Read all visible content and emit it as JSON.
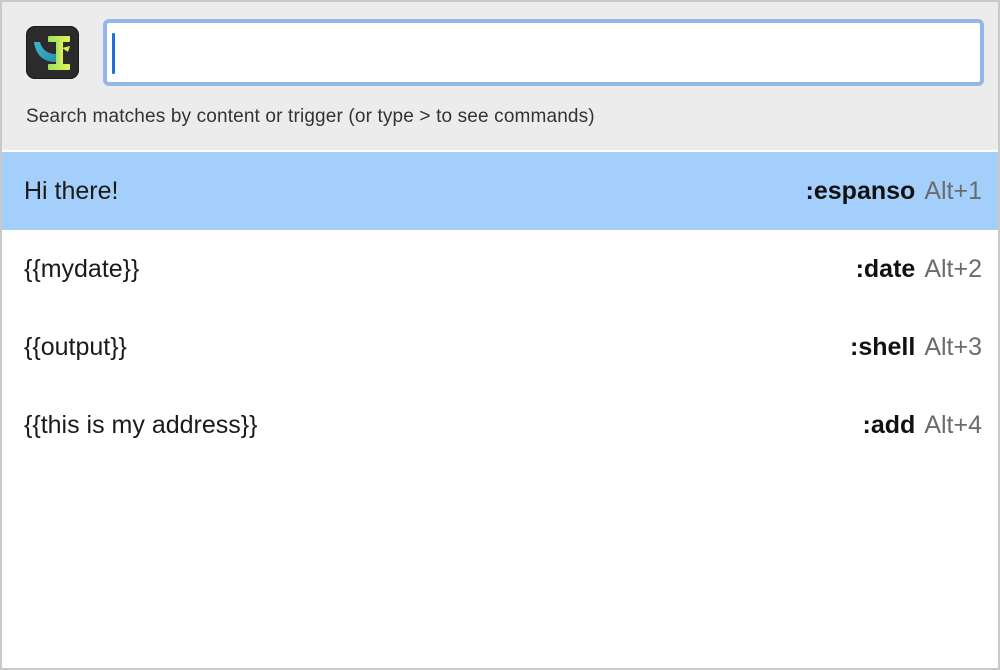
{
  "app": {
    "icon_name": "espanso-logo-icon"
  },
  "search": {
    "value": "",
    "placeholder": "",
    "hint": "Search matches by content or trigger (or type > to see commands)"
  },
  "matches": [
    {
      "label": "Hi there!",
      "trigger": ":espanso",
      "shortcut": "Alt+1",
      "selected": true
    },
    {
      "label": "{{mydate}}",
      "trigger": ":date",
      "shortcut": "Alt+2",
      "selected": false
    },
    {
      "label": "{{output}}",
      "trigger": ":shell",
      "shortcut": "Alt+3",
      "selected": false
    },
    {
      "label": "{{this is my address}}",
      "trigger": ":add",
      "shortcut": "Alt+4",
      "selected": false
    }
  ],
  "colors": {
    "header_bg": "#ececec",
    "selected_row": "#a4cffa",
    "input_focus_border": "#94b7ea",
    "caret": "#1f6fe0"
  }
}
